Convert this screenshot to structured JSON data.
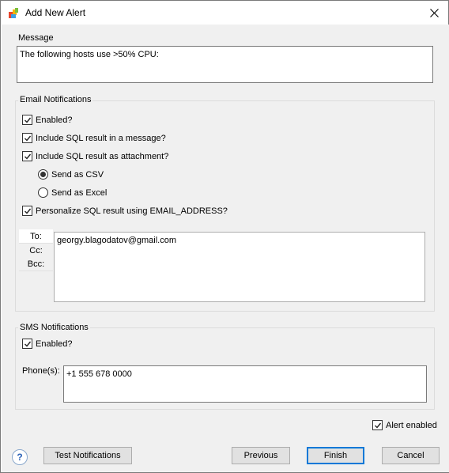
{
  "window": {
    "title": "Add New Alert"
  },
  "message": {
    "label": "Message",
    "value": "The following hosts use >50% CPU:"
  },
  "email": {
    "group_label": "Email Notifications",
    "enabled_label": "Enabled?",
    "enabled": true,
    "include_message_label": "Include SQL result in a message?",
    "include_message": true,
    "include_attachment_label": "Include SQL result as attachment?",
    "include_attachment": true,
    "send_csv_label": "Send as CSV",
    "send_excel_label": "Send as Excel",
    "attachment_format": "CSV",
    "personalize_label": "Personalize SQL result using EMAIL_ADDRESS?",
    "personalize": true,
    "tabs": [
      "To:",
      "Cc:",
      "Bcc:"
    ],
    "active_tab": "To:",
    "recipients": "georgy.blagodatov@gmail.com"
  },
  "sms": {
    "group_label": "SMS Notifications",
    "enabled_label": "Enabled?",
    "enabled": true,
    "phones_label": "Phone(s):",
    "phones": "+1 555 678 0000"
  },
  "alert_enabled_label": "Alert enabled",
  "alert_enabled": true,
  "buttons": {
    "help": "?",
    "test": "Test Notifications",
    "previous": "Previous",
    "finish": "Finish",
    "cancel": "Cancel"
  },
  "icons": {
    "app": "app-logo-icon",
    "close": "close-icon",
    "help": "help-icon",
    "checkmark": "checkmark-icon"
  },
  "colors": {
    "accent": "#0078d7",
    "dialog_bg": "#f0f0f0"
  }
}
